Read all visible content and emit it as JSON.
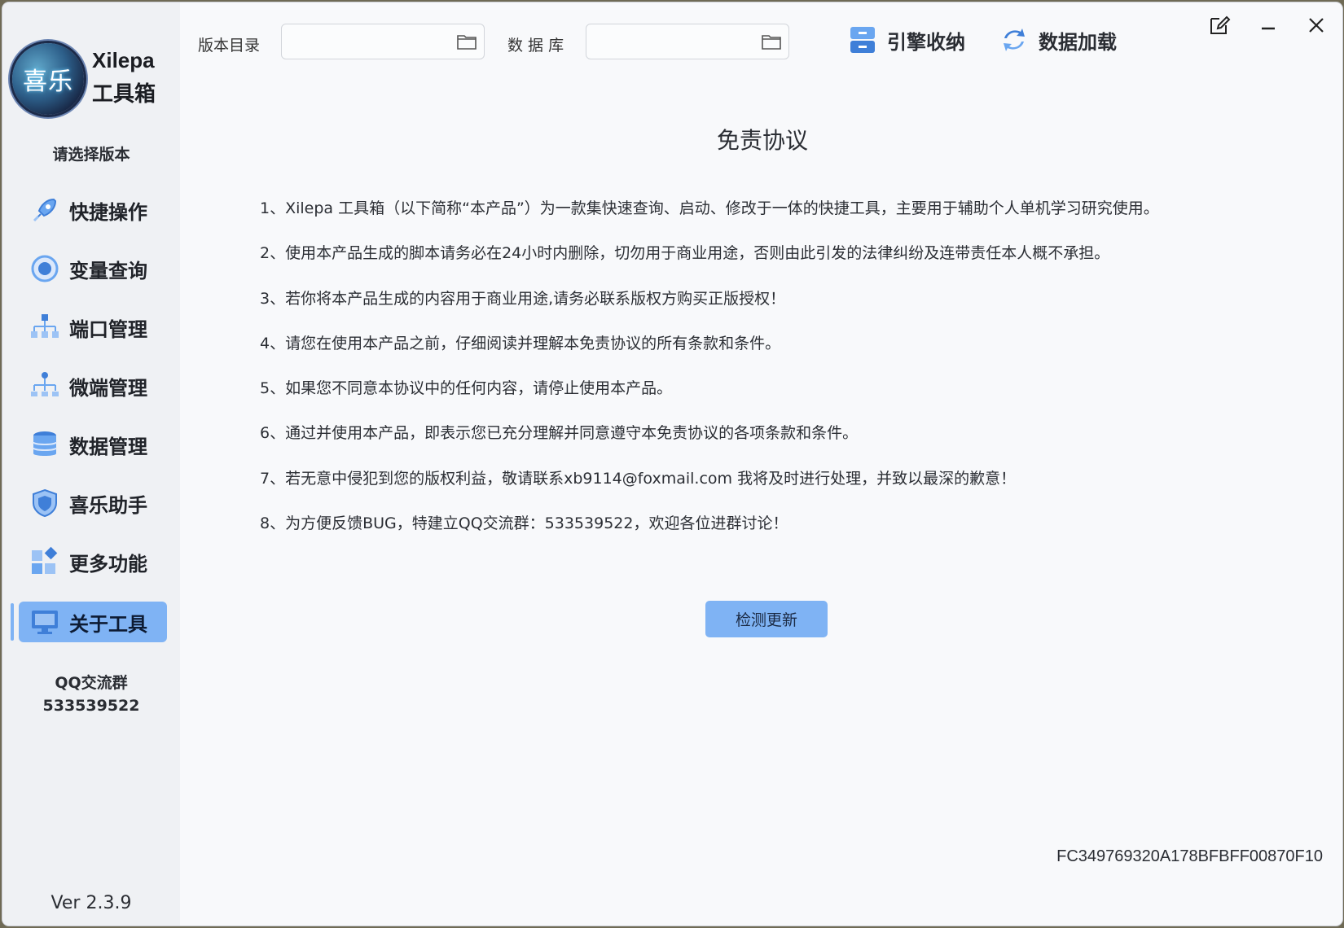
{
  "app": {
    "logo_glyph": "喜乐",
    "name_line1": "Xilepa",
    "name_line2": "工具箱"
  },
  "sidebar": {
    "version_prompt": "请选择版本",
    "items": [
      {
        "label": "快捷操作",
        "icon": "rocket-icon",
        "active": false
      },
      {
        "label": "变量查询",
        "icon": "query-icon",
        "active": false
      },
      {
        "label": "端口管理",
        "icon": "network-icon",
        "active": false
      },
      {
        "label": "微端管理",
        "icon": "hierarchy-icon",
        "active": false
      },
      {
        "label": "数据管理",
        "icon": "database-icon",
        "active": false
      },
      {
        "label": "喜乐助手",
        "icon": "shield-icon",
        "active": false
      },
      {
        "label": "更多功能",
        "icon": "apps-icon",
        "active": false
      },
      {
        "label": "关于工具",
        "icon": "monitor-icon",
        "active": true
      }
    ],
    "qq_title": "QQ交流群",
    "qq_number": "533539522",
    "version": "Ver 2.3.9"
  },
  "topbar": {
    "version_dir_label": "版本目录",
    "version_dir_value": "",
    "database_label": "数 据 库",
    "database_value": "",
    "engine_button": "引擎收纳",
    "data_load_button": "数据加载"
  },
  "main": {
    "title": "免责协议",
    "terms": [
      "1、Xilepa 工具箱（以下简称“本产品”）为一款集快速查询、启动、修改于一体的快捷工具，主要用于辅助个人单机学习研究使用。",
      "2、使用本产品生成的脚本请务必在24小时内删除，切勿用于商业用途，否则由此引发的法律纠纷及连带责任本人概不承担。",
      "3、若你将本产品生成的内容用于商业用途,请务必联系版权方购买正版授权！",
      "4、请您在使用本产品之前，仔细阅读并理解本免责协议的所有条款和条件。",
      "5、如果您不同意本协议中的任何内容，请停止使用本产品。",
      "6、通过并使用本产品，即表示您已充分理解并同意遵守本免责协议的各项条款和条件。",
      "7、若无意中侵犯到您的版权利益，敬请联系xb9114@foxmail.com 我将及时进行处理，并致以最深的歉意！",
      "8、为方便反馈BUG，特建立QQ交流群：533539522，欢迎各位进群讨论！"
    ],
    "check_update_button": "检测更新",
    "machine_code": "FC349769320A178BFBFF00870F10"
  },
  "colors": {
    "accent": "#7fb3f4",
    "sidebar_bg": "#eff1f4",
    "content_bg": "#f8f9fb"
  }
}
